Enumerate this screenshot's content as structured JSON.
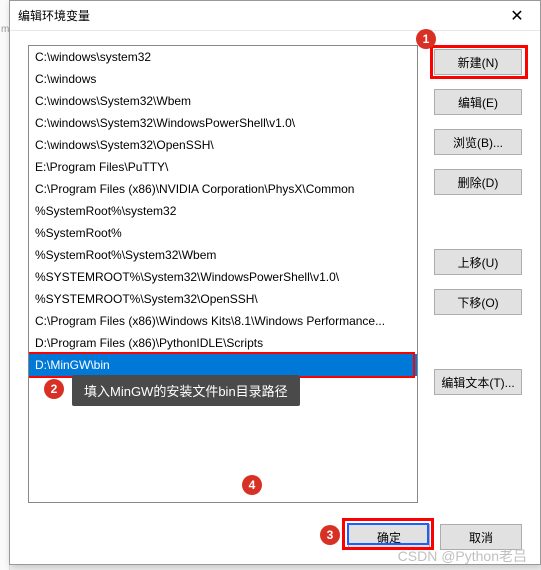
{
  "dialog": {
    "title": "编辑环境变量",
    "close_icon": "✕"
  },
  "path_list": [
    "C:\\windows\\system32",
    "C:\\windows",
    "C:\\windows\\System32\\Wbem",
    "C:\\windows\\System32\\WindowsPowerShell\\v1.0\\",
    "C:\\windows\\System32\\OpenSSH\\",
    "E:\\Program Files\\PuTTY\\",
    "C:\\Program Files (x86)\\NVIDIA Corporation\\PhysX\\Common",
    "%SystemRoot%\\system32",
    "%SystemRoot%",
    "%SystemRoot%\\System32\\Wbem",
    "%SYSTEMROOT%\\System32\\WindowsPowerShell\\v1.0\\",
    "%SYSTEMROOT%\\System32\\OpenSSH\\",
    "C:\\Program Files (x86)\\Windows Kits\\8.1\\Windows Performance...",
    "D:\\Program Files (x86)\\PythonIDLE\\Scripts",
    "D:\\MinGW\\bin"
  ],
  "selected_index": 14,
  "buttons": {
    "new": "新建(N)",
    "edit": "编辑(E)",
    "browse": "浏览(B)...",
    "delete": "删除(D)",
    "move_up": "上移(U)",
    "move_down": "下移(O)",
    "edit_text": "编辑文本(T)...",
    "ok": "确定",
    "cancel": "取消"
  },
  "annotations": {
    "badge1": "1",
    "badge2": "2",
    "badge3": "3",
    "badge4": "4",
    "tooltip": "填入MinGW的安装文件bin目录路径"
  },
  "watermark": "CSDN @Python老吕"
}
